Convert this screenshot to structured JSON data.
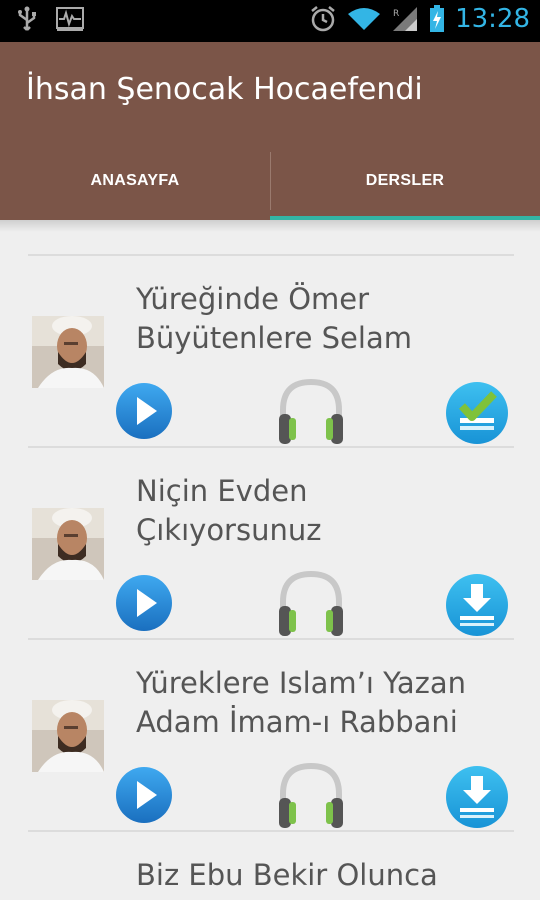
{
  "status_bar": {
    "time": "13:28",
    "accent_color": "#33b5e5"
  },
  "app": {
    "title": "İhsan Şenocak Hocaefendi",
    "bar_color": "#7b5548"
  },
  "tabs": [
    {
      "label": "ANASAYFA",
      "active": false
    },
    {
      "label": "DERSLER",
      "active": true
    }
  ],
  "lessons": [
    {
      "title_line1": "Yüreğinde Ömer",
      "title_line2": "Büyütenlere Selam",
      "downloaded": true
    },
    {
      "title_line1": "Niçin Evden",
      "title_line2": "Çıkıyorsunuz",
      "downloaded": false
    },
    {
      "title_line1": "Yüreklere Islam’ı Yazan",
      "title_line2": "Adam İmam-ı Rabbani",
      "downloaded": false
    }
  ],
  "partial_item": {
    "title": "Biz Ebu Bekir Olunca"
  }
}
